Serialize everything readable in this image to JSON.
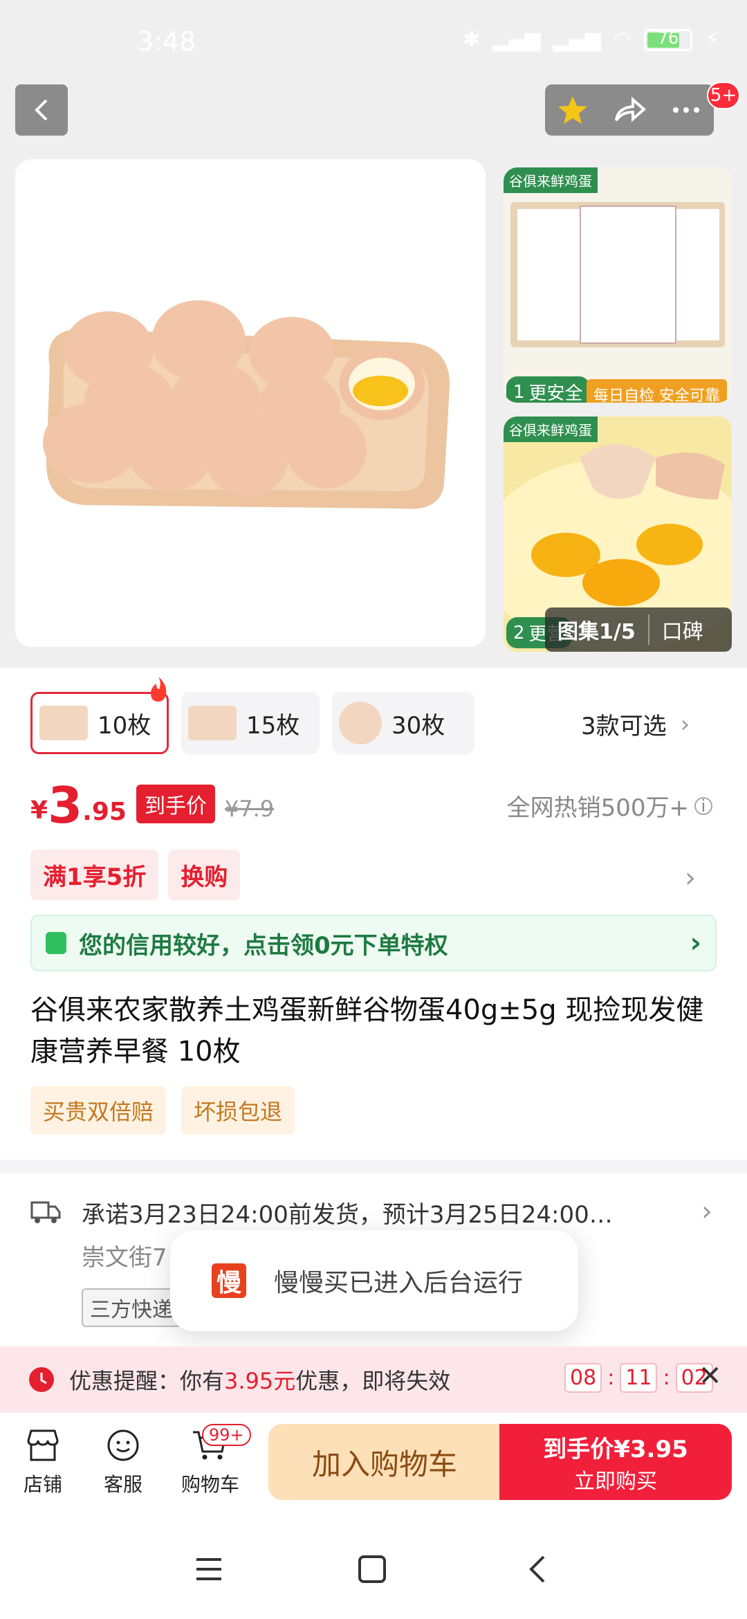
{
  "status_bar": {
    "time": "3:48",
    "battery": "76"
  },
  "header": {
    "notification_badge": "5+"
  },
  "gallery": {
    "counter": "图集1/5",
    "review_tab": "口碑"
  },
  "thumbs": [
    {
      "brand": "谷俱来鲜鸡蛋",
      "label_num": "1",
      "label": "更安全",
      "caption": "每日自检 安全可靠"
    },
    {
      "brand": "谷俱来鲜鸡蛋",
      "label_num": "2",
      "label": "更营"
    }
  ],
  "variants": [
    {
      "label": "10枚",
      "selected": true
    },
    {
      "label": "15枚",
      "selected": false
    },
    {
      "label": "30枚",
      "selected": false
    }
  ],
  "variants_more": "3款可选",
  "price": {
    "currency": "¥",
    "integer": "3",
    "decimal": ".95",
    "tag": "到手价",
    "original": "¥7.9"
  },
  "sales": "全网热销500万+",
  "promos": [
    "满1享5折",
    "换购"
  ],
  "credit_banner": "您的信用较好，点击领0元下单特权",
  "product_title": "谷俱来农家散养土鸡蛋新鲜谷物蛋40g±5g 现捡现发健康营养早餐 10枚",
  "service_tags": [
    "买贵双倍赔",
    "坏损包退"
  ],
  "shipping": {
    "line1": "承诺3月23日24:00前发货，预计3月25日24:00…",
    "line2": "崇文街7",
    "carrier_tag": "三方快递"
  },
  "toast": {
    "icon_char": "慢",
    "message": "慢慢买已进入后台运行"
  },
  "reminder": {
    "prefix": "优惠提醒：你有",
    "amount": "3.95元",
    "suffix": "优惠，即将失效",
    "hh": "08",
    "mm": "11",
    "ss": "02"
  },
  "bottom_nav": [
    {
      "label": "店铺",
      "icon": "store-icon"
    },
    {
      "label": "客服",
      "icon": "service-icon"
    },
    {
      "label": "购物车",
      "icon": "cart-icon",
      "badge": "99+"
    }
  ],
  "actions": {
    "add_to_cart": "加入购物车",
    "buy_price_label": "到手价",
    "buy_price_cur": "¥",
    "buy_price": "3.95",
    "buy_now": "立即购买"
  },
  "colors": {
    "accent_red": "#e41f2f",
    "credit_green": "#1f7a41",
    "cart_bg": "#fde0b8"
  }
}
